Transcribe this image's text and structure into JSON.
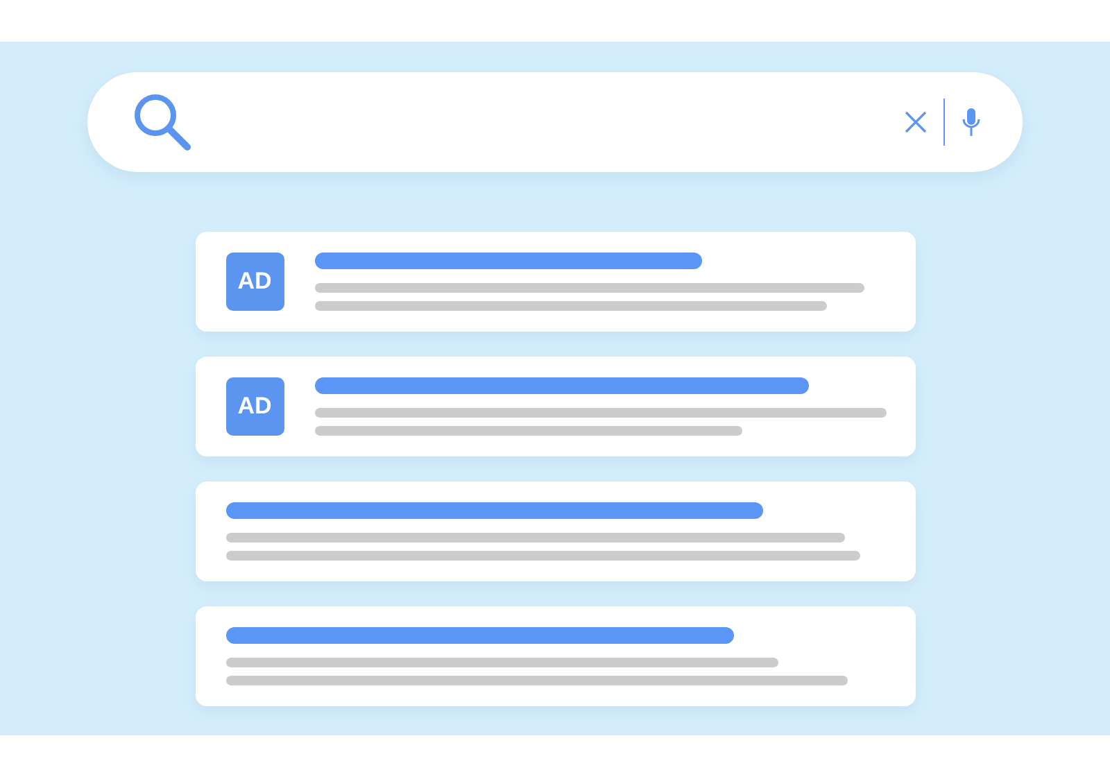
{
  "results": [
    {
      "kind": "ad",
      "badge": "AD"
    },
    {
      "kind": "ad",
      "badge": "AD"
    },
    {
      "kind": "organic"
    },
    {
      "kind": "organic"
    }
  ]
}
